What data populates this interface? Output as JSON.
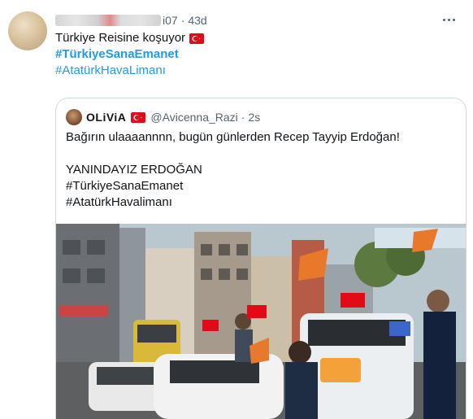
{
  "tweet": {
    "handle_suffix": "i07",
    "separator": "·",
    "time": "43d",
    "line1": "Türkiye Reisine koşuyor",
    "hashtag1": "#TürkiyeSanaEmanet",
    "hashtag2": "#AtatürkHavaLimanı"
  },
  "quote": {
    "display_name": "OLiViA",
    "handle": "@Avicenna_Razi",
    "separator": "·",
    "time": "2s",
    "lines": [
      "Bağırın ulaaaannnn, bugün günlerden Recep Tayyip Erdoğan!",
      "",
      "YANINDAYIZ ERDOĞAN",
      "#TürkiyeSanaEmanet",
      "#AtatürkHavalimanı"
    ]
  },
  "icons": {
    "more": "more-dots-icon",
    "flag": "turkey-flag-icon"
  },
  "colors": {
    "link": "#1d9bf0",
    "muted": "#536471",
    "border": "#cfd9de",
    "flag_red": "#e30a17"
  }
}
